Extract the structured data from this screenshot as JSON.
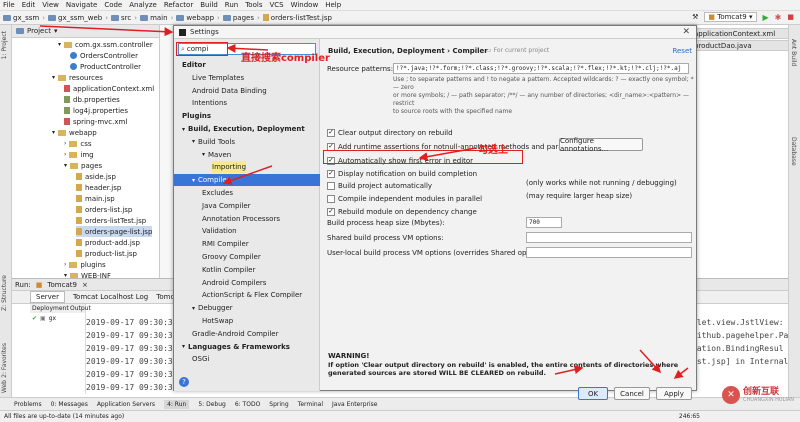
{
  "menubar": {
    "items": [
      "File",
      "Edit",
      "View",
      "Navigate",
      "Code",
      "Analyze",
      "Refactor",
      "Build",
      "Run",
      "Tools",
      "VCS",
      "Window",
      "Help"
    ]
  },
  "navbar": {
    "crumbs": [
      "gx_ssm",
      "gx_ssm_web",
      "src",
      "main",
      "webapp",
      "pages",
      "orders-listTest.jsp"
    ],
    "run_config": "Tomcat9"
  },
  "side_tabs": {
    "project": "1: Project",
    "structure": "Z: Structure",
    "favorites": "2: Favorites",
    "web": "Web",
    "ant": "Ant Build",
    "database": "Database"
  },
  "project_panel": {
    "title": "Project",
    "tree": [
      {
        "label": "com.gx.ssm.controller",
        "kind": "folder"
      },
      {
        "label": "OrdersController",
        "kind": "class"
      },
      {
        "label": "ProductController",
        "kind": "class"
      },
      {
        "label": "resources",
        "kind": "folder"
      },
      {
        "label": "applicationContext.xml",
        "kind": "xml"
      },
      {
        "label": "db.properties",
        "kind": "prop"
      },
      {
        "label": "log4j.properties",
        "kind": "prop"
      },
      {
        "label": "spring-mvc.xml",
        "kind": "xml"
      },
      {
        "label": "webapp",
        "kind": "folder"
      },
      {
        "label": "css",
        "kind": "folder"
      },
      {
        "label": "img",
        "kind": "folder"
      },
      {
        "label": "pages",
        "kind": "folder"
      },
      {
        "label": "aside.jsp",
        "kind": "jsp"
      },
      {
        "label": "header.jsp",
        "kind": "jsp"
      },
      {
        "label": "main.jsp",
        "kind": "jsp"
      },
      {
        "label": "orders-list.jsp",
        "kind": "jsp"
      },
      {
        "label": "orders-listTest.jsp",
        "kind": "jsp"
      },
      {
        "label": "orders-page-list.jsp",
        "kind": "jsp"
      },
      {
        "label": "product-add.jsp",
        "kind": "jsp"
      },
      {
        "label": "product-list.jsp",
        "kind": "jsp"
      },
      {
        "label": "plugins",
        "kind": "folder"
      },
      {
        "label": "WEB-INF",
        "kind": "folder"
      }
    ]
  },
  "editor": {
    "tabs": [
      "applicationContext.xml",
      "productDao.java"
    ]
  },
  "run_panel": {
    "label": "Run:",
    "config": "Tomcat9",
    "tabs": [
      "Server",
      "Tomcat Localhost Log",
      "Tomcat Catalina Log"
    ],
    "columns": [
      "Deployment",
      "Output"
    ],
    "deploy_item": "gx",
    "log_lines": [
      "2019-09-17 09:30:36",
      "2019-09-17 09:30:36",
      "2019-09-17 09:30:36",
      "2019-09-17 09:30:36",
      "2019-09-17 09:30:38",
      "2019-09-17 09:30:38"
    ],
    "log_right": [
      "vlet.view.JstlView:",
      "github.pagehelper.Pa",
      "dation.BindingResul",
      "est.jsp] in Internal"
    ]
  },
  "bottom_tabs": [
    "Problems",
    "0: Messages",
    "Application Servers",
    "4: Run",
    "5: Debug",
    "6: TODO",
    "Spring",
    "Terminal",
    "Java Enterprise"
  ],
  "status": {
    "message": "All files are up-to-date (14 minutes ago)",
    "position": "246:65"
  },
  "watermark": {
    "text": "创新互联",
    "sub": "CHUANGXIN HULIAN"
  },
  "dialog": {
    "title": "Settings",
    "search_value": "compi",
    "nav": [
      {
        "label": "Editor",
        "level": 0,
        "bold": true
      },
      {
        "label": "Live Templates",
        "level": 1
      },
      {
        "label": "Android Data Binding",
        "level": 1
      },
      {
        "label": "Intentions",
        "level": 1
      },
      {
        "label": "Plugins",
        "level": 0,
        "bold": true
      },
      {
        "label": "Build, Execution, Deployment",
        "level": 0,
        "bold": true,
        "arrow": true
      },
      {
        "label": "Build Tools",
        "level": 1,
        "arrow": true
      },
      {
        "label": "Maven",
        "level": 2,
        "arrow": true
      },
      {
        "label": "Importing",
        "level": 3
      },
      {
        "label": "Compiler",
        "level": 1,
        "arrow": true,
        "selected": true
      },
      {
        "label": "Excludes",
        "level": 2
      },
      {
        "label": "Java Compiler",
        "level": 2
      },
      {
        "label": "Annotation Processors",
        "level": 2
      },
      {
        "label": "Validation",
        "level": 2
      },
      {
        "label": "RMI Compiler",
        "level": 2
      },
      {
        "label": "Groovy Compiler",
        "level": 2
      },
      {
        "label": "Kotlin Compiler",
        "level": 2
      },
      {
        "label": "Android Compilers",
        "level": 2
      },
      {
        "label": "ActionScript & Flex Compiler",
        "level": 2
      },
      {
        "label": "Debugger",
        "level": 1,
        "arrow": true
      },
      {
        "label": "HotSwap",
        "level": 2
      },
      {
        "label": "Gradle-Android Compiler",
        "level": 1
      },
      {
        "label": "Languages & Frameworks",
        "level": 0,
        "bold": true,
        "arrow": true
      },
      {
        "label": "OSGi",
        "level": 1
      }
    ],
    "breadcrumb": "Build, Execution, Deployment  ›  Compiler",
    "for_current_project": "For current project",
    "reset": "Reset",
    "resource_patterns_label": "Resource patterns:",
    "resource_patterns_value": "!?*.java;!?*.form;!?*.class;!?*.groovy;!?*.scala;!?*.flex;!?*.kt;!?*.clj;!?*.aj",
    "resource_hint": [
      "Use ; to separate patterns and ! to negate a pattern. Accepted wildcards: ? — exactly one symbol; * — zero",
      "or more symbols; / — path separator; /**/ — any number of directories; <dir_name>:<pattern> — restrict",
      "to source roots with the specified name"
    ],
    "options": [
      {
        "label": "Clear output directory on rebuild",
        "checked": true
      },
      {
        "label": "Add runtime assertions for notnull-annotated methods and parameters",
        "checked": true
      },
      {
        "label": "Automatically show first error in editor",
        "checked": true
      },
      {
        "label": "Display notification on build completion",
        "checked": true
      },
      {
        "label": "Build project automatically",
        "checked": false
      },
      {
        "label": "Compile independent modules in parallel",
        "checked": false
      },
      {
        "label": "Rebuild module on dependency change",
        "checked": true
      }
    ],
    "configure_annotations": "Configure annotations...",
    "note_auto": "(only works while not running / debugging)",
    "note_parallel": "(may require larger heap size)",
    "heap_label": "Build process heap size (Mbytes):",
    "heap_value": "700",
    "shared_vm_label": "Shared build process VM options:",
    "shared_vm_value": "",
    "user_vm_label": "User-local build process VM options (overrides Shared options):",
    "user_vm_value": "",
    "warning_title": "WARNING!",
    "warning_text": "If option 'Clear output directory on rebuild' is enabled, the entire contents of directories where generated sources are stored WILL BE CLEARED on rebuild.",
    "ok": "OK",
    "cancel": "Cancel",
    "apply": "Apply"
  },
  "annotations": {
    "search_note": "直接搜索compiler",
    "check_note": "勾选上"
  },
  "colors": {
    "annotation": "#e02020",
    "selection": "#3875d7"
  }
}
